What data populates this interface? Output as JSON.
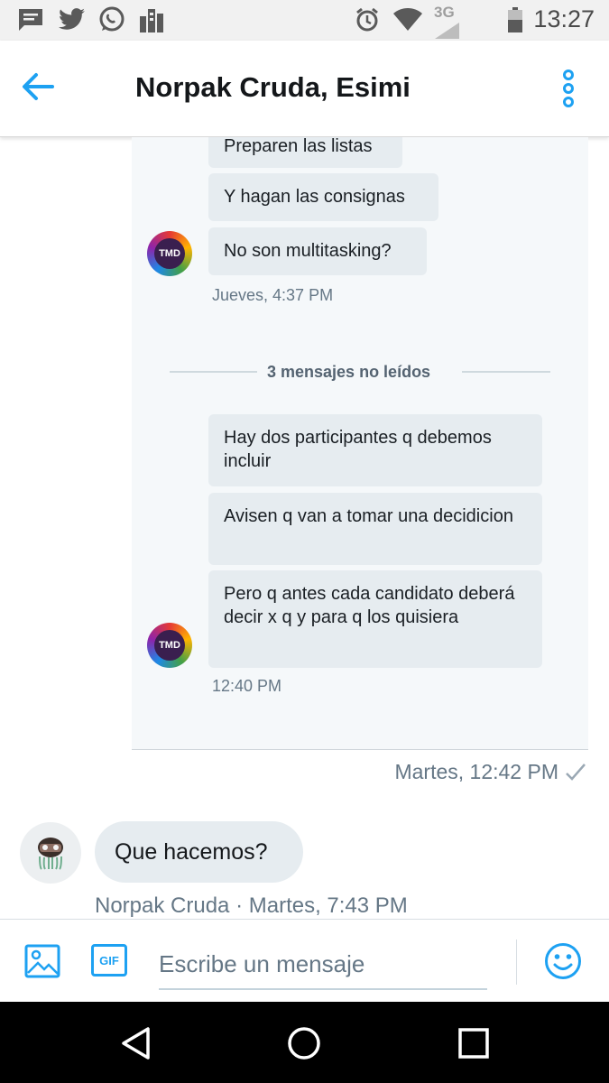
{
  "status_bar": {
    "time": "13:27",
    "network": "3G",
    "icons": [
      "message-icon",
      "twitter-icon",
      "whatsapp-icon",
      "city-icon",
      "alarm-icon",
      "wifi-icon",
      "battery-icon"
    ]
  },
  "header": {
    "title": "Norpak Cruda, Esimi",
    "back_icon": "arrow-left-icon",
    "menu_icon": "more-vertical-icon",
    "accent_color": "#1da1f2"
  },
  "shared_screenshot": {
    "messages_top": [
      {
        "text": "Preparen las listas"
      },
      {
        "text": "Y hagan las consignas"
      },
      {
        "text": "No son multitasking?"
      }
    ],
    "timestamp_1": "Jueves, 4:37 PM",
    "unread_divider": "3 mensajes no leídos",
    "messages_bottom": [
      {
        "text": "Hay dos participantes q debemos incluir"
      },
      {
        "text": "Avisen q van a tomar una decidicion"
      },
      {
        "text": "Pero q antes cada candidato deberá decir x q y para q los quisiera"
      }
    ],
    "timestamp_2": "12:40 PM",
    "avatar_label": "TMD"
  },
  "sent_meta": {
    "text": "Martes, 12:42 PM",
    "status_icon": "check-icon"
  },
  "received": {
    "text": "Que hacemos?",
    "meta": "Norpak Cruda · Martes, 7:43 PM"
  },
  "composer": {
    "placeholder": "Escribe un mensaje",
    "gif_label": "GIF",
    "image_icon": "image-icon",
    "emoji_icon": "emoji-icon"
  },
  "nav": {
    "icons": [
      "back-triangle-icon",
      "home-circle-icon",
      "recents-square-icon"
    ]
  }
}
